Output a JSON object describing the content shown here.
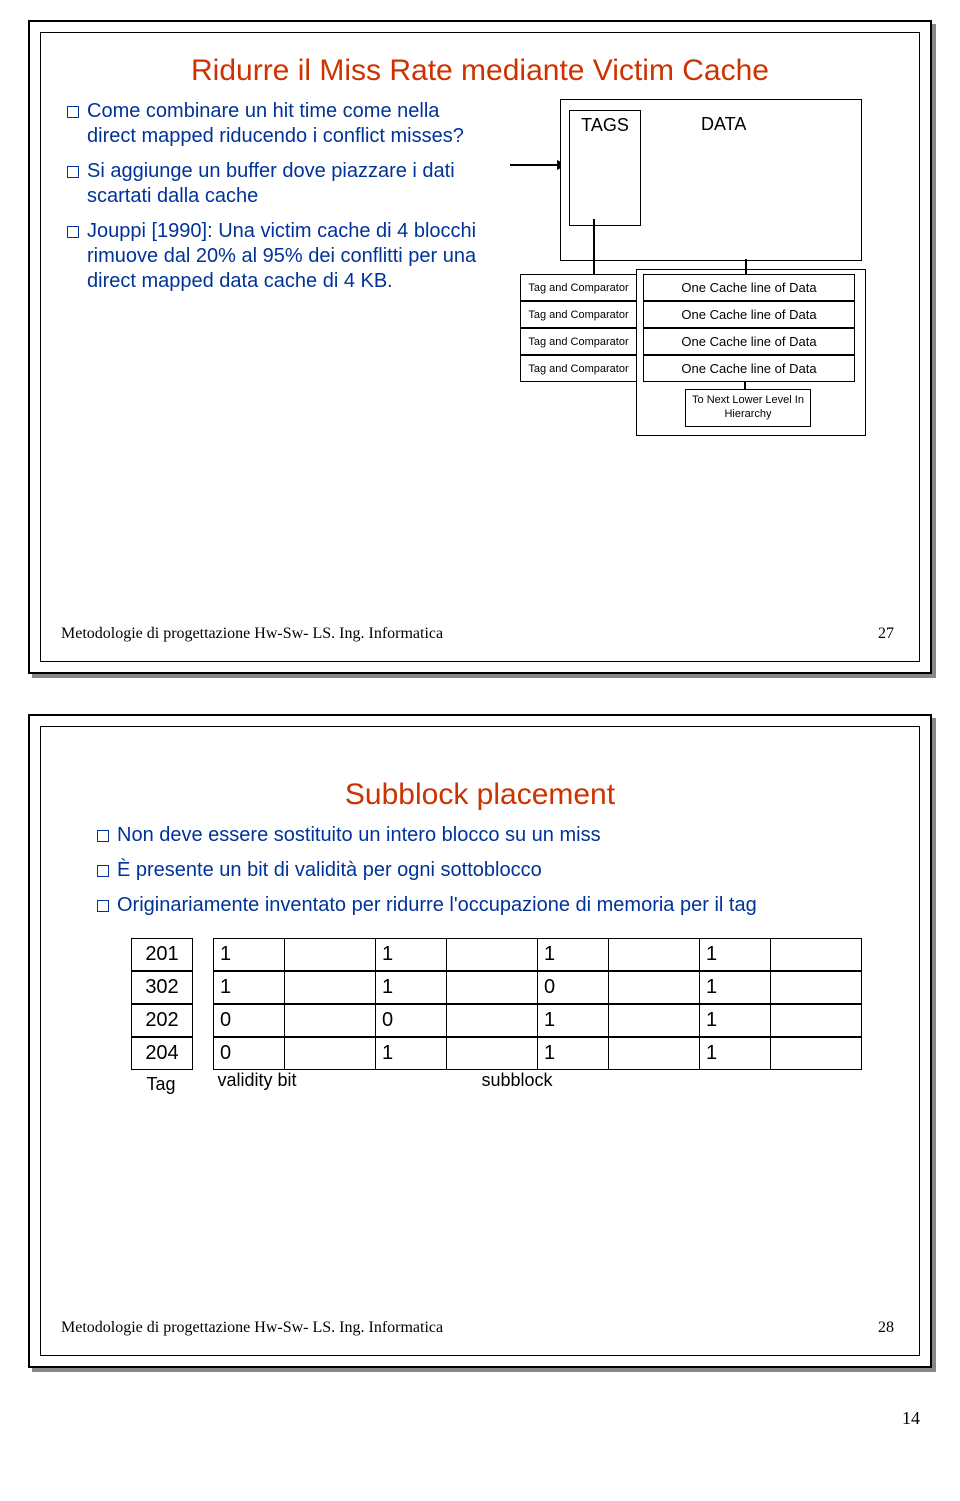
{
  "slide1": {
    "title": "Ridurre il Miss Rate mediante Victim Cache",
    "bullets": [
      "Come combinare un hit time come nella direct mapped riducendo i conflict misses?",
      "Si aggiunge un buffer dove piazzare i dati scartati dalla cache",
      "Jouppi [1990]: Una victim cache di 4 blocchi rimuove dal 20% al 95% dei conflitti per una direct mapped data cache di 4 KB."
    ],
    "diagram": {
      "tags": "TAGS",
      "data": "DATA",
      "tag_comp": "Tag and Comparator",
      "line": "One Cache line of Data",
      "hier": "To Next Lower Level In Hierarchy"
    },
    "footer_left": "Metodologie di progettazione Hw-Sw- LS. Ing. Informatica",
    "footer_right": "27"
  },
  "slide2": {
    "title": "Subblock placement",
    "bullets": [
      "Non deve essere sostituito un intero blocco su un miss",
      "È presente un bit di validità per ogni sottoblocco",
      "Originariamente inventato per ridurre l'occupazione di memoria per il tag"
    ],
    "table": {
      "rows": [
        {
          "tag": "201",
          "v": [
            "1",
            "1",
            "1",
            "1"
          ]
        },
        {
          "tag": "302",
          "v": [
            "1",
            "1",
            "0",
            "1"
          ]
        },
        {
          "tag": "202",
          "v": [
            "0",
            "0",
            "1",
            "1"
          ]
        },
        {
          "tag": "204",
          "v": [
            "0",
            "1",
            "1",
            "1"
          ]
        }
      ],
      "lbl_tag": "Tag",
      "lbl_valid": "validity bit",
      "lbl_sub": "subblock"
    },
    "footer_left": "Metodologie di progettazione Hw-Sw- LS. Ing. Informatica",
    "footer_right": "28"
  },
  "page_number": "14"
}
